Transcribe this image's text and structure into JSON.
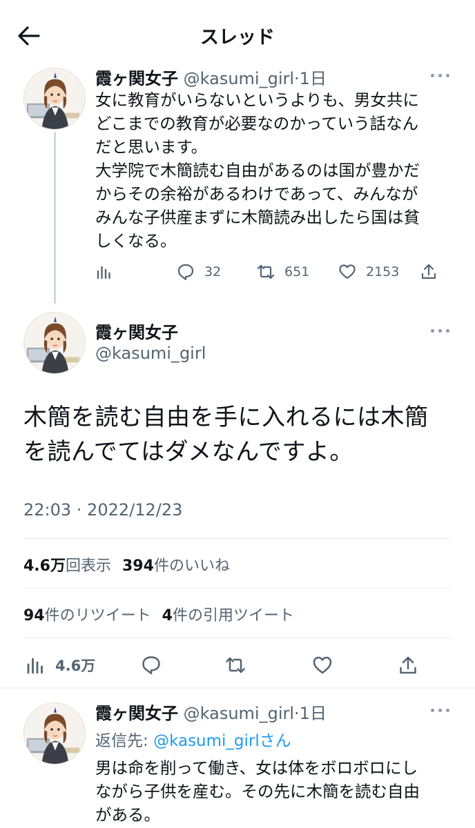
{
  "header": {
    "title": "スレッド"
  },
  "tweets": [
    {
      "name": "霞ヶ関女子",
      "handle": "@kasumi_girl",
      "sep": "·",
      "time": "1日",
      "text": "女に教育がいらないというよりも、男女共に\nどこまでの教育が必要なのかっていう話なん\nだと思います。\n大学院で木簡読む自由があるのは国が豊かだ\nからその余裕があるわけであって、みんなが\nみんな子供産まずに木簡読み出したら国は貧\nしくなる。",
      "replies": "32",
      "retweets": "651",
      "likes": "2153"
    }
  ],
  "main": {
    "name": "霞ヶ関女子",
    "handle": "@kasumi_girl",
    "text": "木簡を読む自由を手に入れるには木簡\nを読んでてはダメなんですよ。",
    "timestamp": "22:03 · 2022/12/23",
    "views_value": "4.6万",
    "views_label": "回表示",
    "likes_value": "394",
    "likes_label": "件のいいね",
    "retweets_value": "94",
    "retweets_label": "件のリツイート",
    "quotes_value": "4",
    "quotes_label": "件の引用ツイート",
    "views_count_action": "4.6万"
  },
  "reply": {
    "name": "霞ヶ関女子",
    "handle": "@kasumi_girl",
    "sep": "·",
    "time": "1日",
    "reply_prefix": "返信先: ",
    "reply_mention": "@kasumi_girl",
    "reply_suffix": "さん",
    "text": "男は命を削って働き、女は体をボロボロにし\nながら子供を産む。その先に木簡を読む自由\nがある。"
  },
  "icons": {
    "back": "back-arrow-icon",
    "views": "analytics-icon",
    "reply": "reply-icon",
    "retweet": "retweet-icon",
    "like": "heart-icon",
    "share": "share-icon",
    "more": "more-icon"
  },
  "colors": {
    "text": "#0f1419",
    "secondary": "#536471",
    "accent": "#1d9bf0",
    "divider": "#e6ecf0"
  }
}
